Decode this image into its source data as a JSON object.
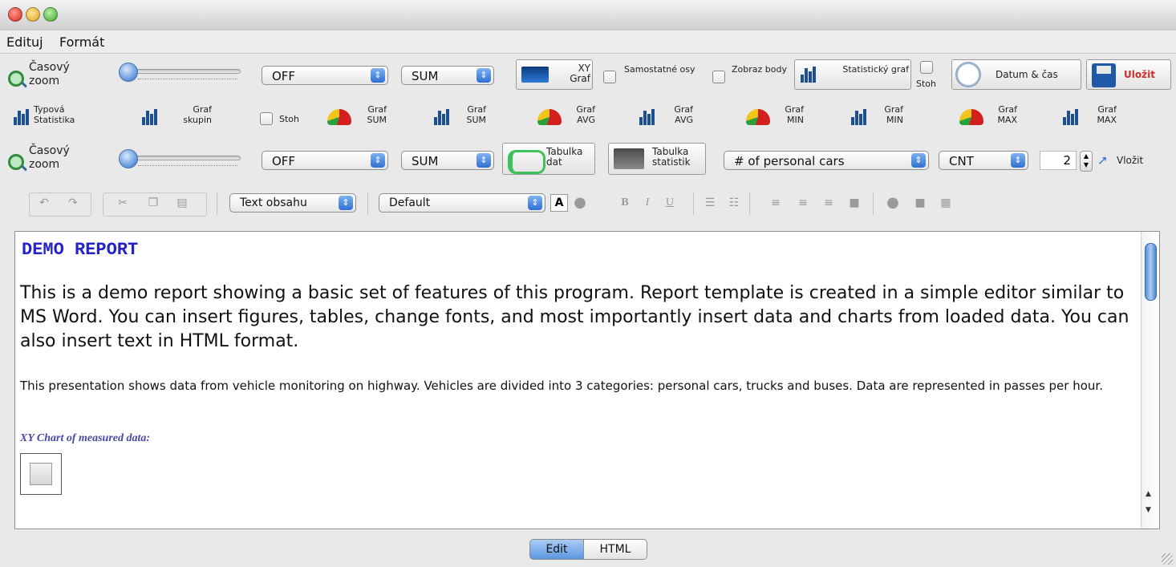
{
  "menu": [
    "Edituj",
    "Formát"
  ],
  "toolbar1": {
    "zoom_label": "Časový zoom",
    "select1": "OFF",
    "select2": "SUM",
    "xy_label": "XY Graf",
    "cb1_label": "Samostatné osy",
    "cb2_label": "Zobraz body",
    "stat_label": "Statistický graf",
    "stoh_label": "Stoh",
    "datetime_label": "Datum & čas",
    "save_label": "Uložit"
  },
  "toolbar2": {
    "typova": "Typová Statistika",
    "skupin": "Graf skupin",
    "stoh": "Stoh",
    "items": [
      "Graf SUM",
      "Graf SUM",
      "Graf AVG",
      "Graf AVG",
      "Graf MIN",
      "Graf MIN",
      "Graf MAX",
      "Graf MAX"
    ]
  },
  "toolbar3": {
    "zoom_label": "Časový zoom",
    "select1": "OFF",
    "select2": "SUM",
    "tab_dat": "Tabulka dat",
    "tab_stat": "Tabulka statistik",
    "variable": "# of personal cars",
    "agg": "CNT",
    "spinner_value": "2",
    "insert_label": "Vložit"
  },
  "format": {
    "style_select": "Text obsahu",
    "font_select": "Default"
  },
  "editor": {
    "heading": "DEMO REPORT",
    "para1": "This is a demo report showing a basic set of features of this program. Report template is created in a simple editor similar to MS Word. You can insert figures, tables, change fonts, and most importantly insert data and charts from loaded data. You can also insert text in HTML format.",
    "para2": "This presentation shows data from vehicle monitoring on highway. Vehicles are divided into 3 categories: personal cars, trucks and buses. Data are represented in passes per hour.",
    "caption": "XY Chart of measured data:"
  },
  "tabs": {
    "edit": "Edit",
    "html": "HTML"
  },
  "colors": {
    "heading": "#2323c8",
    "save": "#d42a2a",
    "accent": "#2f6fd1"
  }
}
